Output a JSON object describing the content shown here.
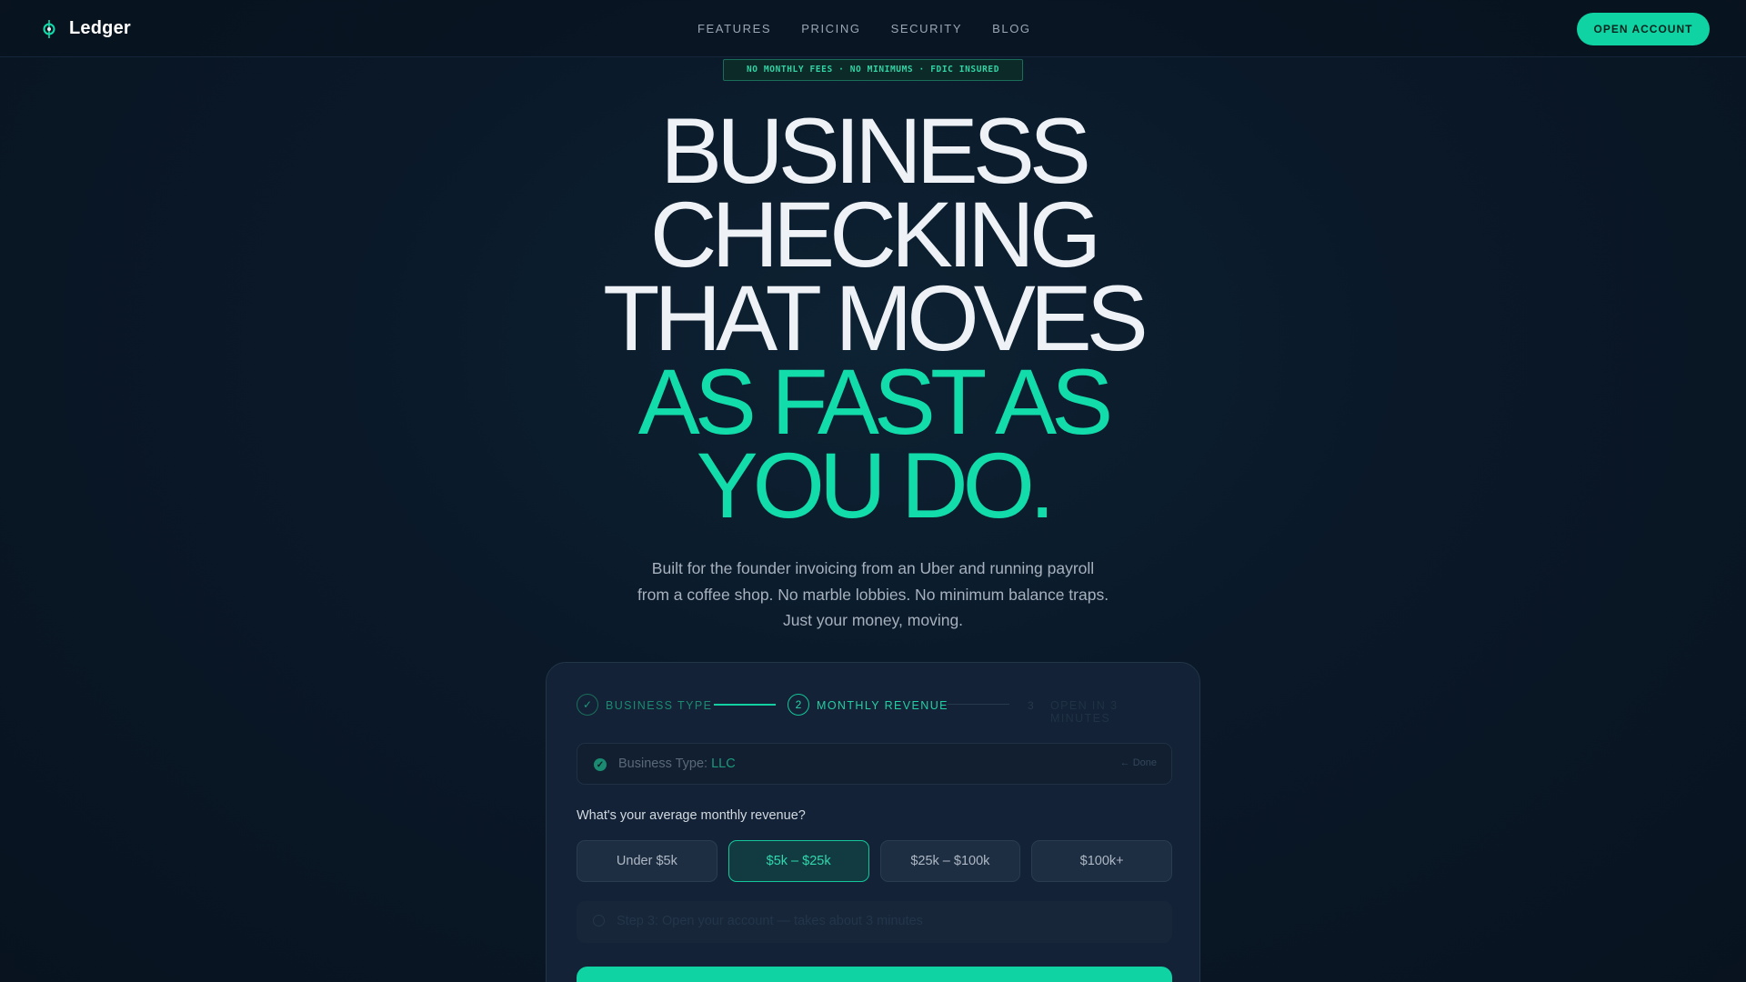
{
  "nav": {
    "brand": "Ledger",
    "links": [
      "FEATURES",
      "PRICING",
      "SECURITY",
      "BLOG"
    ],
    "cta": "OPEN ACCOUNT"
  },
  "hero": {
    "badge": "NO MONTHLY FEES · NO MINIMUMS · FDIC INSURED",
    "headline_white": [
      "BUSINESS",
      "CHECKING",
      "THAT MOVES"
    ],
    "headline_accent": [
      "AS FAST AS",
      "YOU DO."
    ],
    "subtitle": "Built for the founder invoicing from an Uber and running payroll from a coffee shop. No marble lobbies. No minimum balance traps. Just your money, moving."
  },
  "form": {
    "steps": [
      {
        "label": "BUSINESS TYPE",
        "state": "complete"
      },
      {
        "number": "2",
        "label": "MONTHLY REVENUE",
        "state": "active"
      },
      {
        "number": "3",
        "label": "OPEN IN 3 MINUTES",
        "state": "pending"
      }
    ],
    "completed": {
      "label": "Business Type:",
      "value": "LLC",
      "tag": "Done"
    },
    "question": "What's your average monthly revenue?",
    "options": [
      "Under $5k",
      "$5k – $25k",
      "$25k – $100k",
      "$100k+"
    ],
    "selected_option": "$5k – $25k",
    "next_step": "Step 3: Open your account — takes about 3 minutes"
  },
  "colors": {
    "accent": "#10d3a4",
    "background": "#0a1828",
    "card": "#132236"
  }
}
